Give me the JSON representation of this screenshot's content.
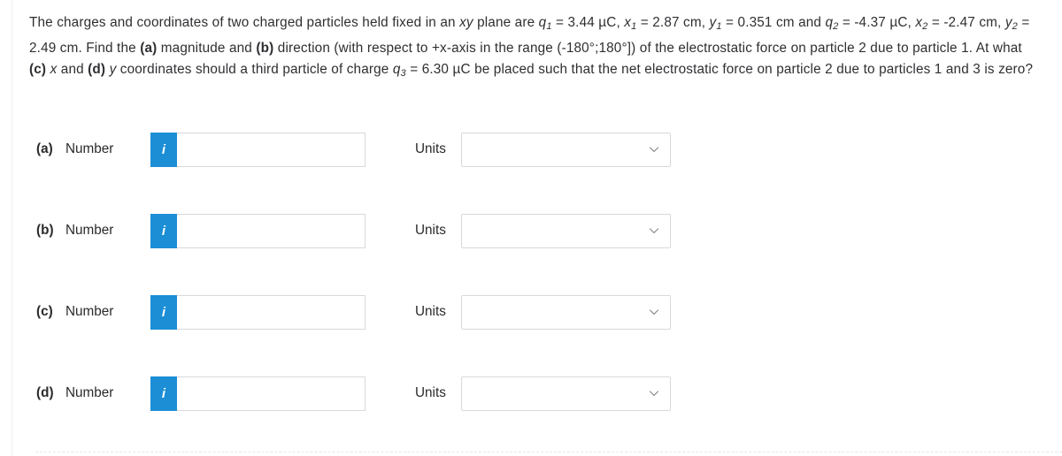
{
  "question": {
    "text_plain": "The charges and coordinates of two charged particles held fixed in an xy plane are q1 = 3.44 µC, x1 = 2.87 cm, y1 = 0.351 cm and q2 = -4.37 µC, x2 = -2.47 cm, y2 = 2.49 cm. Find the (a) magnitude and (b) direction (with respect to +x-axis in the range (-180°;180°]) of the electrostatic force on particle 2 due to particle 1. At what (c) x and (d) y coordinates should a third particle of charge q3 = 6.30 µC be placed such that the net electrostatic force on particle 2 due to particles 1 and 3 is zero?",
    "seg": {
      "s1": "The charges and coordinates of two charged particles held fixed in an ",
      "plane_var": "xy",
      "s2": " plane are ",
      "q1": "q",
      "q1sub": "1",
      "q1val": " = 3.44 µC, ",
      "x1": "x",
      "x1sub": "1",
      "x1val": " = 2.87 cm, ",
      "y1": "y",
      "y1sub": "1",
      "y1val": " = 0.351 cm and",
      "q2": "q",
      "q2sub": "2",
      "q2val": " = -4.37 µC, ",
      "x2": "x",
      "x2sub": "2",
      "x2val": " = -2.47 cm, ",
      "y2": "y",
      "y2sub": "2",
      "y2val": " = 2.49 cm. Find the ",
      "lbl_a": "(a)",
      "s3": " magnitude and ",
      "lbl_b": "(b)",
      "s4": " direction (with respect to +x-axis in the range (-180°;180°]) of",
      "s5": "the electrostatic force on particle 2 due to particle 1. At what ",
      "lbl_c": "(c)",
      "s6": " ",
      "x_var": "x",
      "s7": " and ",
      "lbl_d": "(d)",
      "s8": " ",
      "y_var": "y",
      "s9": " coordinates should a third particle of charge ",
      "q3": "q",
      "q3sub": "3",
      "q3val": " = 6.30 µC",
      "s10": "be placed such that the net electrostatic force on particle 2 due to particles 1 and 3 is zero?"
    }
  },
  "answers": {
    "number_label": "Number",
    "units_label": "Units",
    "info_icon": "i",
    "chevron_icon": "chevron-down-icon",
    "rows": [
      {
        "label": "(a)",
        "number_label": "Number",
        "number_value": "",
        "number_placeholder": "",
        "units_label": "Units",
        "units_value": "",
        "units_options": []
      },
      {
        "label": "(b)",
        "number_label": "Number",
        "number_value": "",
        "number_placeholder": "",
        "units_label": "Units",
        "units_value": "",
        "units_options": []
      },
      {
        "label": "(c)",
        "number_label": "Number",
        "number_value": "",
        "number_placeholder": "",
        "units_label": "Units",
        "units_value": "",
        "units_options": []
      },
      {
        "label": "(d)",
        "number_label": "Number",
        "number_value": "",
        "number_placeholder": "",
        "units_label": "Units",
        "units_value": "",
        "units_options": []
      }
    ]
  },
  "colors": {
    "accent_blue": "#1b8ed6",
    "text": "#2b2b2b",
    "border": "#d9d9dd",
    "rule": "#f0f0f2"
  }
}
